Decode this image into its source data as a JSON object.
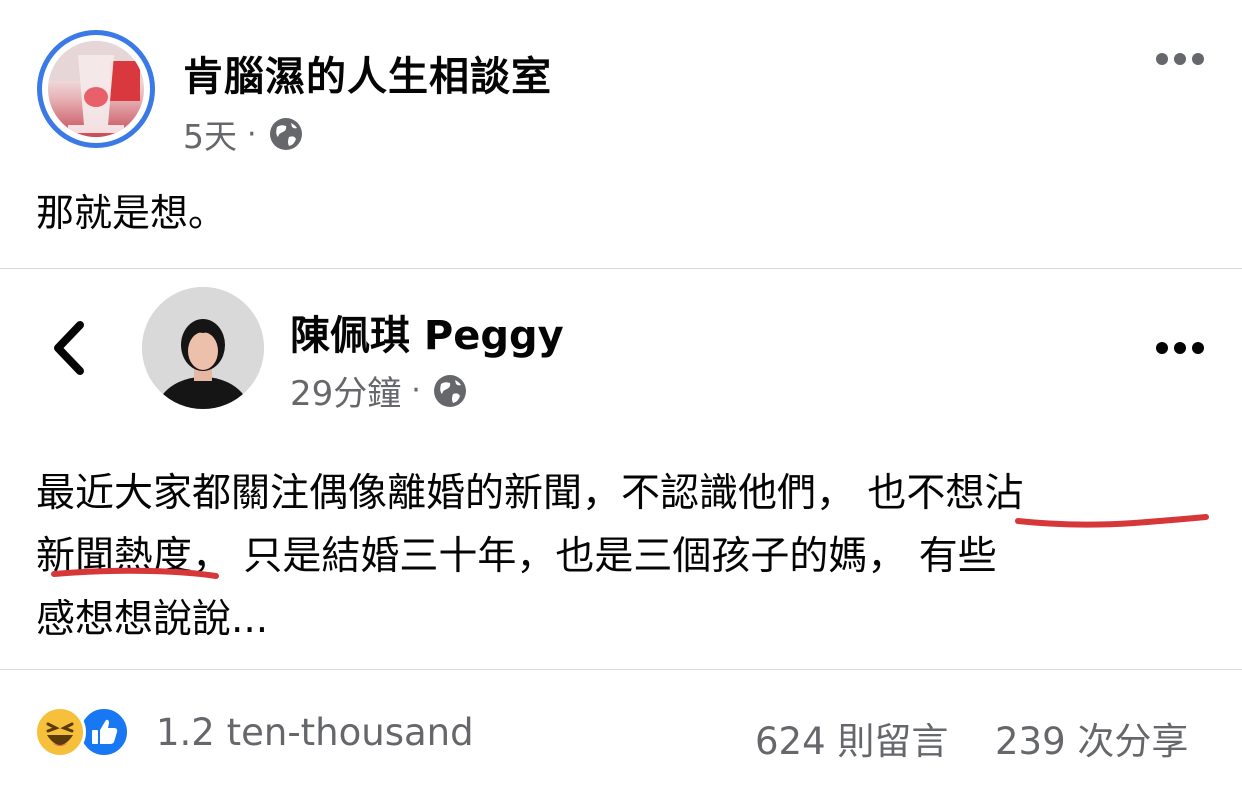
{
  "page": {
    "name": "肯腦濕的人生相談室",
    "time": "5天",
    "separator": "·",
    "audience_icon": "globe-icon",
    "post_text": "那就是想。"
  },
  "shared_post": {
    "author": "陳佩琪 Peggy",
    "time": "29分鐘",
    "separator": "·",
    "audience_icon": "globe-icon",
    "body_lines": [
      "最近大家都關注偶像離婚的新聞，不認識他們， 也不想沾",
      "新聞熱度， 只是結婚三十年，也是三個孩子的媽， 有些",
      "感想想說說..."
    ],
    "highlight_color": "#d6383a"
  },
  "footer": {
    "reactions": [
      "haha-icon",
      "like-icon"
    ],
    "reaction_count": "1.2 ten-thousand",
    "comments": "624 則留言",
    "shares": "239 次分享"
  },
  "colors": {
    "accent": "#3b7ae6",
    "like_blue": "#1877f2",
    "muted_text": "#65676b",
    "divider": "#d9dadc"
  }
}
